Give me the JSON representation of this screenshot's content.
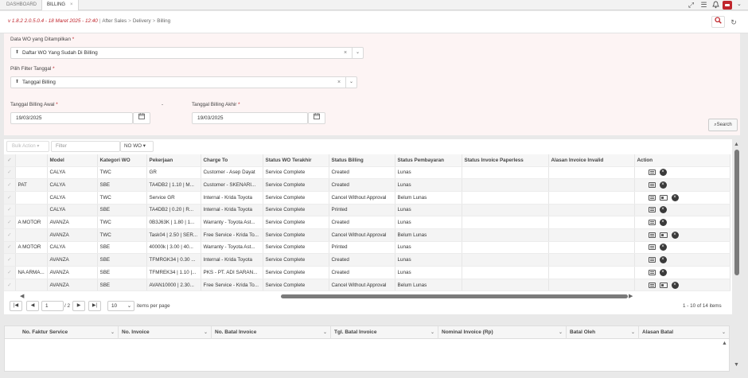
{
  "tabs": [
    {
      "label": "DASHBOARD"
    },
    {
      "label": "BILLING",
      "close": "×"
    }
  ],
  "breadcrumb": {
    "version": "v 1.8.2 2.0.5.0.4 - 18 Maret 2025 - 12:40",
    "items": [
      "After Sales",
      "Delivery",
      "Billing"
    ]
  },
  "form": {
    "wo_label": "Data WO yang Ditampilkan",
    "wo_value": "Daftar WO Yang Sudah Di Billing",
    "filter_label": "Pilih Filter Tanggal",
    "filter_value": "Tanggal Billing",
    "start_label": "Tanggal Billing Awal",
    "start_value": "19/03/2025",
    "dash": "-",
    "end_label": "Tanggal Billing Akhir",
    "end_value": "19/03/2025",
    "required_mark": "*",
    "search_label": "Search"
  },
  "grid_toolbar": {
    "bulk_action": "Bulk Action",
    "filter_placeholder": "Filter",
    "nowo_label": "NO WO"
  },
  "grid": {
    "columns": [
      "",
      "",
      "Model",
      "Kategori WO",
      "Pekerjaan",
      "Charge To",
      "Status WO Terakhir",
      "Status Billing",
      "Status Pembayaran",
      "Status Invoice Paperless",
      "Alasan Invoice Invalid",
      "Action"
    ],
    "rows": [
      {
        "c1": "",
        "model": "CALYA",
        "kat": "TWC",
        "pek": "GR",
        "charge": "Customer - Asep Dayat",
        "wo": "Service Complete",
        "bill": "Created",
        "bayar": "Lunas",
        "actions": [
          "card",
          "x"
        ]
      },
      {
        "c1": "PAT",
        "model": "CALYA",
        "kat": "SBE",
        "pek": "TA4DB2 | 1.10 | M...",
        "charge": "Customer - SKENARI...",
        "wo": "Service Complete",
        "bill": "Created",
        "bayar": "Lunas",
        "actions": [
          "card",
          "x"
        ]
      },
      {
        "c1": "",
        "model": "CALYA",
        "kat": "TWC",
        "pek": "Service GR",
        "charge": "Internal - Krida Toyota",
        "wo": "Service Complete",
        "bill": "Cancel Without Approval",
        "bayar": "Belum Lunas",
        "actions": [
          "card",
          "id",
          "x"
        ]
      },
      {
        "c1": "",
        "model": "CALYA",
        "kat": "SBE",
        "pek": "TA4DB2 | 0.20 | R...",
        "charge": "Internal - Krida Toyota",
        "wo": "Service Complete",
        "bill": "Printed",
        "bayar": "Lunas",
        "actions": [
          "card",
          "x"
        ]
      },
      {
        "c1": "A MOTOR",
        "model": "AVANZA",
        "kat": "TWC",
        "pek": "0B3J63K | 1.80 | 1...",
        "charge": "Warranty - Toyota Ast...",
        "wo": "Service Complete",
        "bill": "Created",
        "bayar": "Lunas",
        "actions": [
          "card",
          "x"
        ]
      },
      {
        "c1": "",
        "model": "AVANZA",
        "kat": "TWC",
        "pek": "Task04 | 2.50 | SER...",
        "charge": "Free Service - Krida To...",
        "wo": "Service Complete",
        "bill": "Cancel Without Approval",
        "bayar": "Belum Lunas",
        "actions": [
          "card",
          "id",
          "x"
        ]
      },
      {
        "c1": "A MOTOR",
        "model": "CALYA",
        "kat": "SBE",
        "pek": "40000k | 3.00 | 40...",
        "charge": "Warranty - Toyota Ast...",
        "wo": "Service Complete",
        "bill": "Printed",
        "bayar": "Lunas",
        "actions": [
          "card",
          "x"
        ]
      },
      {
        "c1": "",
        "model": "AVANZA",
        "kat": "SBE",
        "pek": "TFMRGK34 | 0.30 ...",
        "charge": "Internal - Krida Toyota",
        "wo": "Service Complete",
        "bill": "Created",
        "bayar": "Lunas",
        "actions": [
          "card",
          "x"
        ]
      },
      {
        "c1": "NA ARMA...",
        "model": "AVANZA",
        "kat": "SBE",
        "pek": "TFMREK34 | 1.10 |...",
        "charge": "PKS - PT. ADI SARAN...",
        "wo": "Service Complete",
        "bill": "Created",
        "bayar": "Lunas",
        "actions": [
          "card",
          "x"
        ]
      },
      {
        "c1": "",
        "model": "AVANZA",
        "kat": "SBE",
        "pek": "AVAN10000 | 2.30...",
        "charge": "Free Service - Krida To...",
        "wo": "Service Complete",
        "bill": "Cancel Without Approval",
        "bayar": "Belum Lunas",
        "actions": [
          "card",
          "id",
          "x"
        ]
      }
    ]
  },
  "pager": {
    "page": "1",
    "of": "/ 2",
    "page_size": "10",
    "items_per_page": "items per page",
    "summary": "1 - 10 of 14 items"
  },
  "grid2": {
    "columns": [
      "No. Faktur Service",
      "No. Invoice",
      "No. Batal Invoice",
      "Tgl. Batal Invoice",
      "Nominal Invoice (Rp)",
      "Batal Oleh",
      "Alasan Batal"
    ]
  },
  "colors": {
    "accent": "#c0262d",
    "form_bg": "#fdf4f4"
  }
}
